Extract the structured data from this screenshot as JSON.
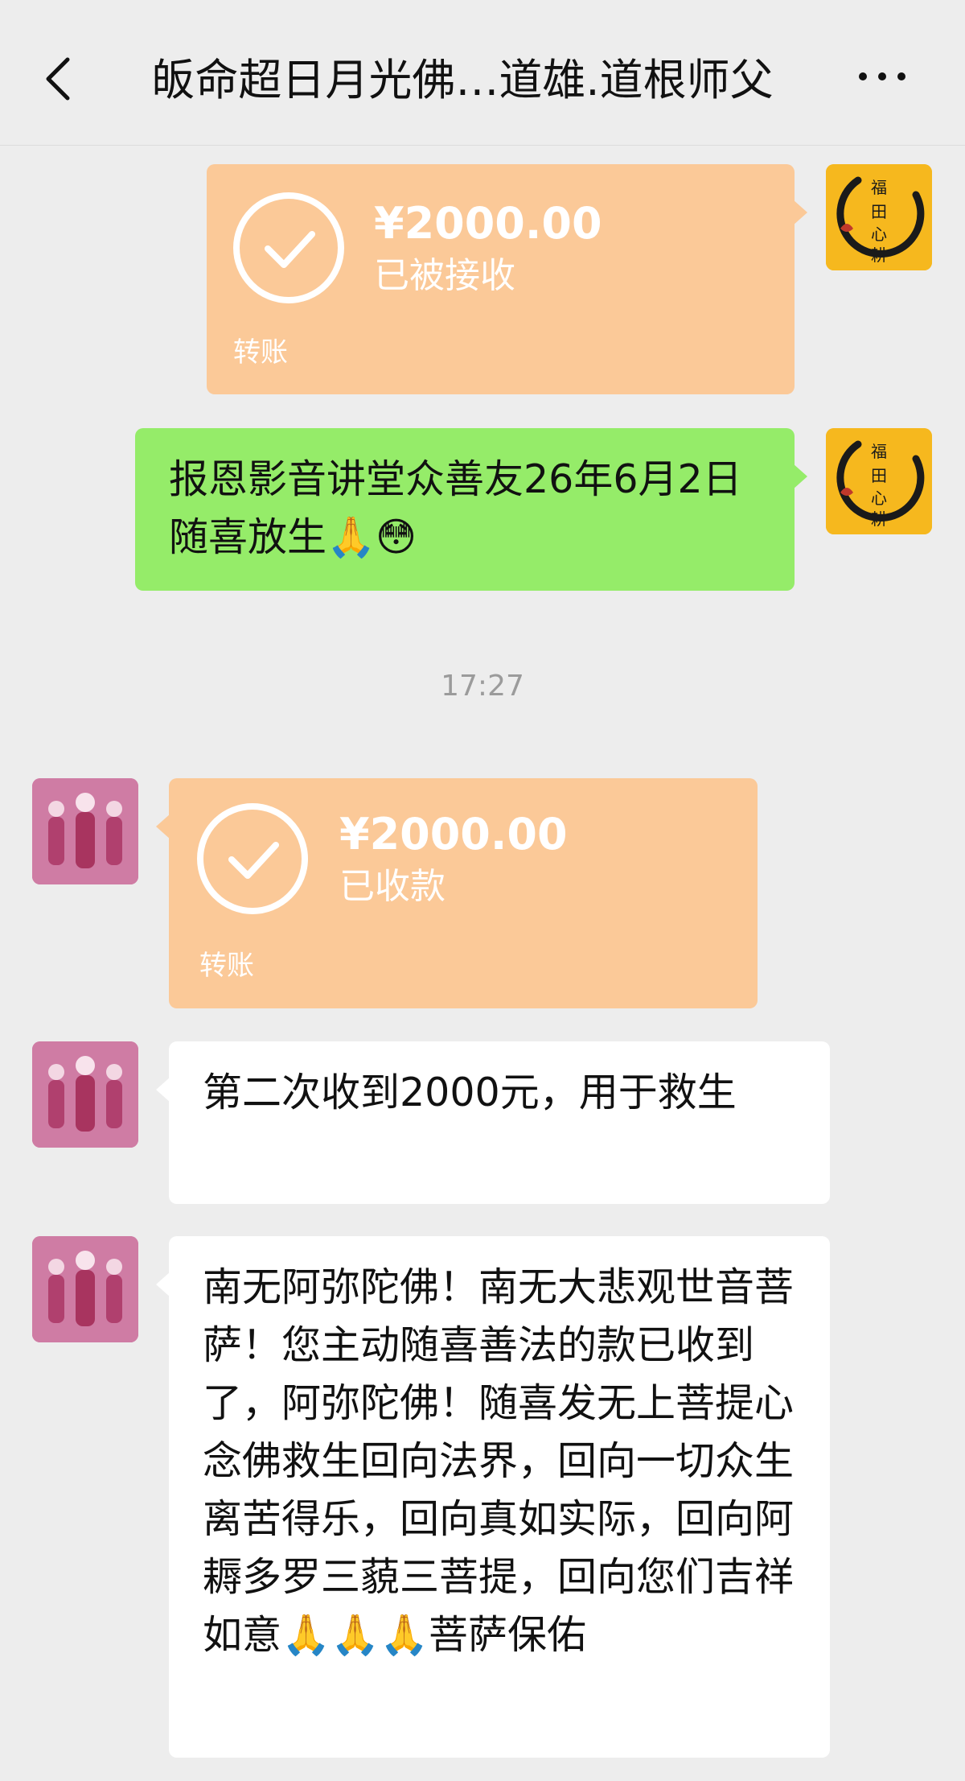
{
  "header": {
    "title": "皈命超日月光佛…道雄.道根师父",
    "back_icon": "chevron-left-icon",
    "more_icon": "more-dots-icon"
  },
  "messages": [
    {
      "type": "transfer",
      "side": "self",
      "amount": "¥2000.00",
      "status": "已被接收",
      "label": "转账",
      "avatar_text": "福田心耕"
    },
    {
      "type": "text",
      "side": "self",
      "text": "报恩影音讲堂众善友26年6月2日随喜放生🙏😳",
      "avatar_text": "福田心耕"
    },
    {
      "type": "time",
      "text": "17:27"
    },
    {
      "type": "transfer",
      "side": "other",
      "amount": "¥2000.00",
      "status": "已收款",
      "label": "转账"
    },
    {
      "type": "text",
      "side": "other",
      "text": "第二次收到2000元，用于救生"
    },
    {
      "type": "text",
      "side": "other",
      "text": "南无阿弥陀佛！南无大悲观世音菩萨！您主动随喜善法的款已收到了，阿弥陀佛！随喜发无上菩提心念佛救生回向法界，回向一切众生离苦得乐，回向真如实际，回向阿耨多罗三藐三菩提，回向您们吉祥如意🙏🙏🙏菩萨保佑"
    }
  ],
  "colors": {
    "background": "#ededed",
    "transfer_bubble": "#fbc998",
    "self_text_bubble": "#95ec69",
    "other_text_bubble": "#ffffff",
    "avatar_self": "#f6b81e"
  }
}
